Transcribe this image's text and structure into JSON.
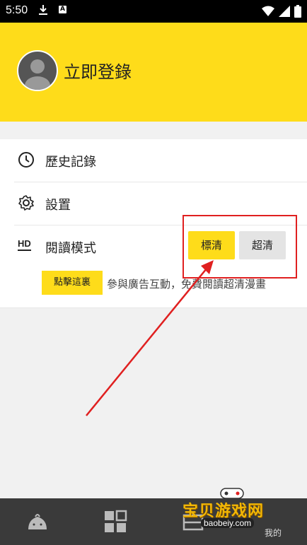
{
  "status_bar": {
    "time": "5:50",
    "a_badge": "A"
  },
  "header": {
    "login_text": "立即登錄"
  },
  "menu": {
    "history_label": "歷史記錄",
    "settings_label": "設置",
    "reading_mode_label": "閱讀模式",
    "reading_mode_icon_text": "HD",
    "quality_options": {
      "standard": "標清",
      "hd": "超清"
    },
    "click_here_label": "點擊這裏",
    "ad_text": "參與廣告互動，免費閱讀超清漫畫"
  },
  "colors": {
    "accent": "#fedc1a",
    "annotation": "#e02020",
    "nav_bg": "#3a3a3a"
  },
  "watermark": {
    "title": "宝贝游戏网",
    "url": "baobeiy.com",
    "mine_label": "我的"
  },
  "icons": [
    "avatar-icon",
    "clock-icon",
    "gear-icon",
    "hd-icon",
    "bun-icon",
    "grid-icon",
    "shelf-icon",
    "download-icon",
    "wifi-icon",
    "signal-icon",
    "battery-icon"
  ]
}
